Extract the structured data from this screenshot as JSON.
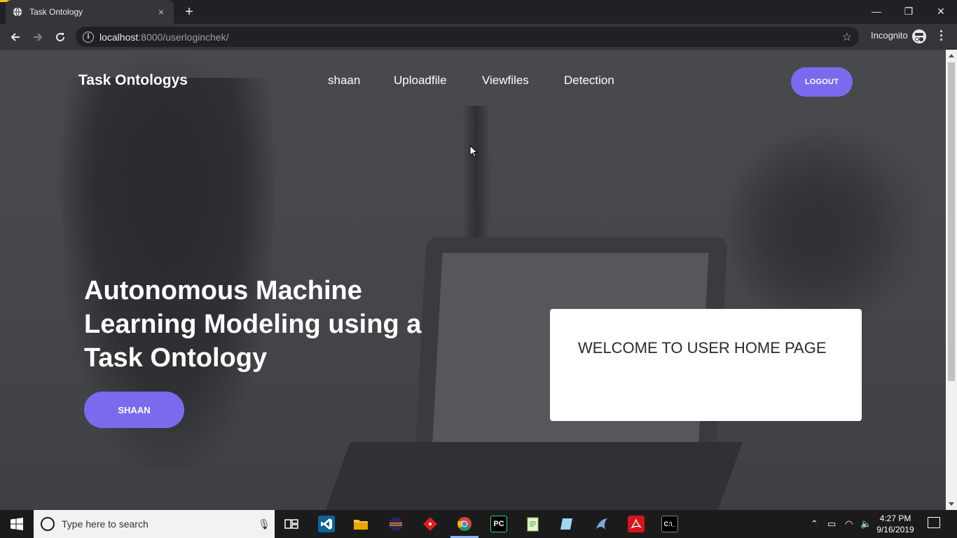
{
  "browser": {
    "tab_title": "Task Ontology",
    "tab_close": "×",
    "new_tab": "+",
    "url_host": "localhost",
    "url_path": ":8000/userloginchek/",
    "mode_label": "Incognito",
    "window_controls": {
      "minimize": "—",
      "restore": "❐",
      "close": "✕"
    }
  },
  "site": {
    "brand": "Task Ontologys",
    "nav": [
      "shaan",
      "Uploadfile",
      "Viewfiles",
      "Detection"
    ],
    "logout_label": "LOGOUT",
    "headline": "Autonomous Machine Learning Modeling using a Task Ontology",
    "cta_label": "SHAAN",
    "welcome_text": "WELCOME TO USER HOME PAGE",
    "accent_color": "#7a6bee"
  },
  "taskbar": {
    "search_placeholder": "Type here to search",
    "time": "4:27 PM",
    "date": "9/16/2019",
    "pinned_apps": [
      "task-view-icon",
      "vscode-icon",
      "file-explorer-icon",
      "eclipse-icon",
      "git-icon",
      "chrome-icon",
      "pycharm-icon",
      "notepad-plus-icon",
      "document-icon",
      "mysql-icon",
      "acrobat-icon",
      "terminal-icon"
    ]
  }
}
